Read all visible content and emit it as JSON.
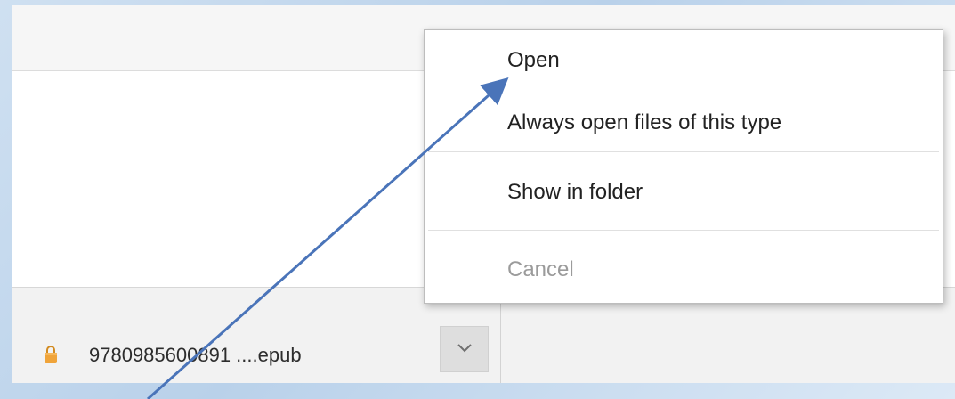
{
  "download_shelf": {
    "file_name": "9780985600891 ....epub",
    "file_icon": "lock-icon",
    "dropdown_icon": "chevron-down-icon"
  },
  "context_menu": {
    "items": [
      {
        "label": "Open"
      },
      {
        "label": "Always open files of this type"
      },
      {
        "label": "Show in folder"
      },
      {
        "label": "Cancel",
        "disabled": true
      }
    ]
  },
  "annotation": {
    "arrow_color": "#4a74b9"
  }
}
